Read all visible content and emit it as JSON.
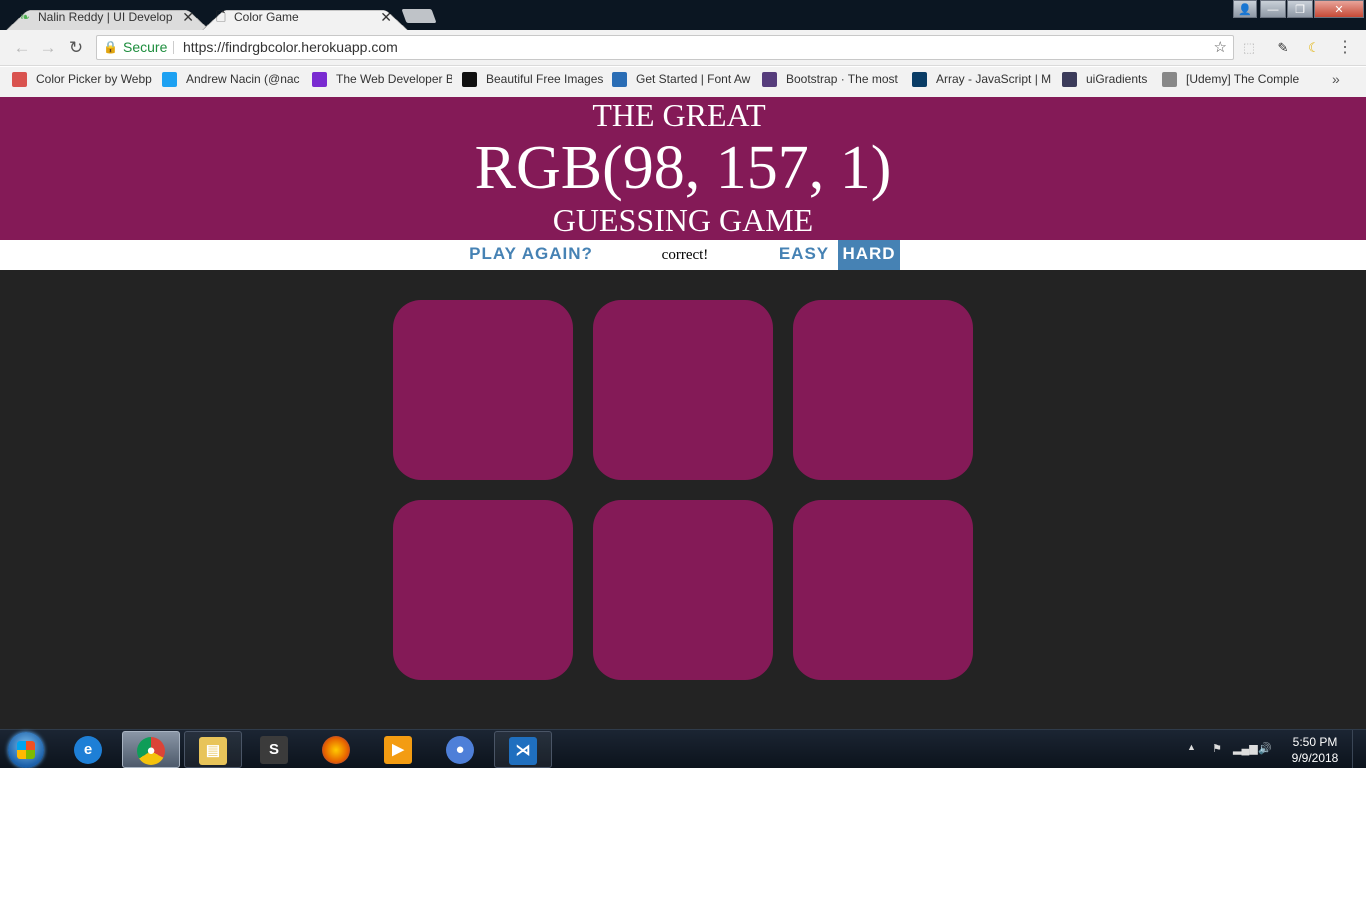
{
  "browser": {
    "tabs": [
      {
        "title": "Nalin Reddy | UI Develop",
        "close": "✕",
        "favicon": "leaf-icon"
      },
      {
        "title": "Color Game",
        "close": "✕",
        "favicon": "page-icon"
      }
    ],
    "address": {
      "secure_label": "Secure",
      "url": "https://findrgbcolor.herokuapp.com"
    },
    "bookmarks": [
      {
        "label": "Color Picker by Webp",
        "icon": "palette-icon",
        "color": "#d9534f"
      },
      {
        "label": "Andrew Nacin (@nac",
        "icon": "twitter-icon",
        "color": "#1da1f2"
      },
      {
        "label": "The Web Developer B",
        "icon": "udemy-icon",
        "color": "#7a2bd1"
      },
      {
        "label": "Beautiful Free Images",
        "icon": "camera-icon",
        "color": "#111111"
      },
      {
        "label": "Get Started | Font Aw",
        "icon": "flag-icon",
        "color": "#2a6db5"
      },
      {
        "label": "Bootstrap · The most",
        "icon": "bootstrap-icon",
        "color": "#563d7c"
      },
      {
        "label": "Array - JavaScript | M",
        "icon": "mdn-icon",
        "color": "#0a3d66"
      },
      {
        "label": "uiGradients",
        "icon": "gradient-icon",
        "color": "#3b3b5a"
      },
      {
        "label": "[Udemy] The Comple",
        "icon": "page-icon",
        "color": "#888888"
      }
    ],
    "more_bookmarks": "»"
  },
  "game": {
    "title_line1": "THE GREAT",
    "color_display": "RGB(98, 157, 1)",
    "title_line3": "GUESSING GAME",
    "header_color": "#841a57",
    "reset_label": "Play Again?",
    "message": "correct!",
    "easy_label": "Easy",
    "hard_label": "Hard",
    "selected_mode": "hard",
    "accent_color": "#4682b4",
    "background_color": "#232323",
    "square_colors": [
      "#841a57",
      "#841a57",
      "#841a57",
      "#841a57",
      "#841a57",
      "#841a57"
    ]
  },
  "taskbar": {
    "apps": [
      "ie-icon",
      "chrome-icon",
      "explorer-icon",
      "sublime-icon",
      "firefox-icon",
      "media-player-icon",
      "chromium-icon",
      "vscode-icon"
    ],
    "time": "5:50 PM",
    "date": "9/9/2018"
  }
}
